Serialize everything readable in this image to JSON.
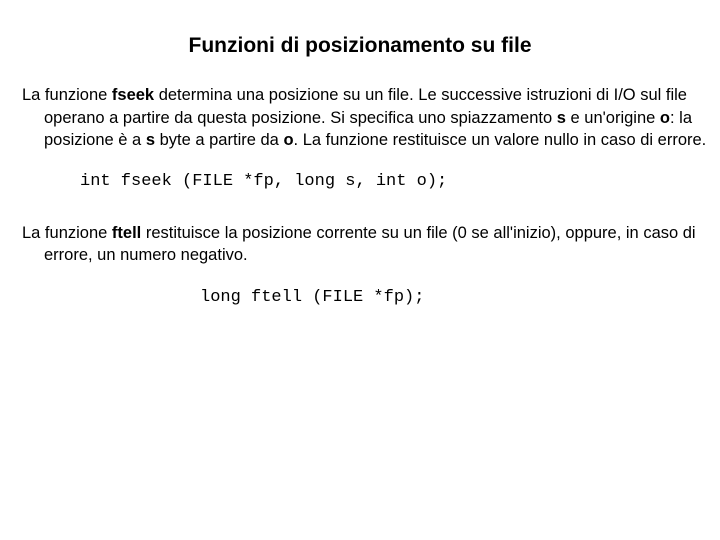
{
  "title": "Funzioni di posizionamento su file",
  "p1": {
    "t1": "La funzione ",
    "b1": "fseek",
    "t2": " determina una posizione su un file. Le successive istruzioni di I/O sul file operano a partire da questa posizione. Si specifica uno spiazzamento ",
    "b2": "s",
    "t3": " e un'origine ",
    "b3": "o",
    "t4": ": la posizione è a ",
    "b4": "s",
    "t5": " byte a partire da ",
    "b5": "o",
    "t6": ". La funzione restituisce un valore nullo in caso di errore."
  },
  "code1": "int fseek (FILE *fp, long s, int o);",
  "p2": {
    "t1": "La funzione ",
    "b1": "ftell",
    "t2": " restituisce la posizione corrente su un file (0 se all'inizio), oppure, in caso di errore, un numero negativo."
  },
  "code2": "long ftell (FILE *fp);"
}
